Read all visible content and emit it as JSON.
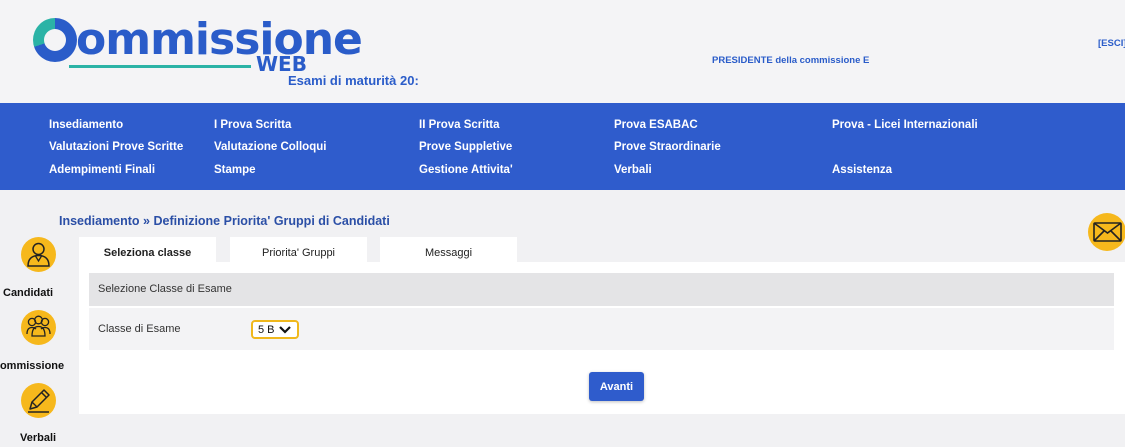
{
  "header": {
    "logo_main": "ommissione",
    "logo_web": "WEB",
    "logo_subtitle": "Esami di maturità 20:",
    "role": "PRESIDENTE della commissione E",
    "exit_label": "[ESCI]"
  },
  "nav": {
    "rows": [
      [
        "Insediamento",
        "I Prova Scritta",
        "II Prova Scritta",
        "Prova ESABAC",
        "Prova - Licei Internazionali"
      ],
      [
        "Valutazioni Prove Scritte",
        "Valutazione Colloqui",
        "Prove Suppletive",
        "Prove Straordinarie"
      ],
      [
        "Adempimenti Finali",
        "Stampe",
        "Gestione Attivita'",
        "Verbali",
        "Assistenza"
      ]
    ]
  },
  "breadcrumb": "Insediamento » Definizione Priorita' Gruppi di Candidati",
  "side_menu": [
    {
      "label": "Candidati",
      "icon": "graduate-icon"
    },
    {
      "label": "Commissione",
      "icon": "group-icon"
    },
    {
      "label": "Verbali",
      "icon": "pencil-icon"
    }
  ],
  "mail_icon": "mail-icon",
  "tabs": [
    {
      "label": "Seleziona classe",
      "active": true
    },
    {
      "label": "Priorita' Gruppi",
      "active": false
    },
    {
      "label": "Messaggi",
      "active": false
    }
  ],
  "form": {
    "section_title": "Selezione Classe di Esame",
    "field_label": "Classe di Esame",
    "selected_class": "5 B",
    "next_label": "Avanti"
  },
  "colors": {
    "brand_blue": "#2f5ccc",
    "accent_yellow": "#f6b81c",
    "teal": "#2bb3a6"
  }
}
